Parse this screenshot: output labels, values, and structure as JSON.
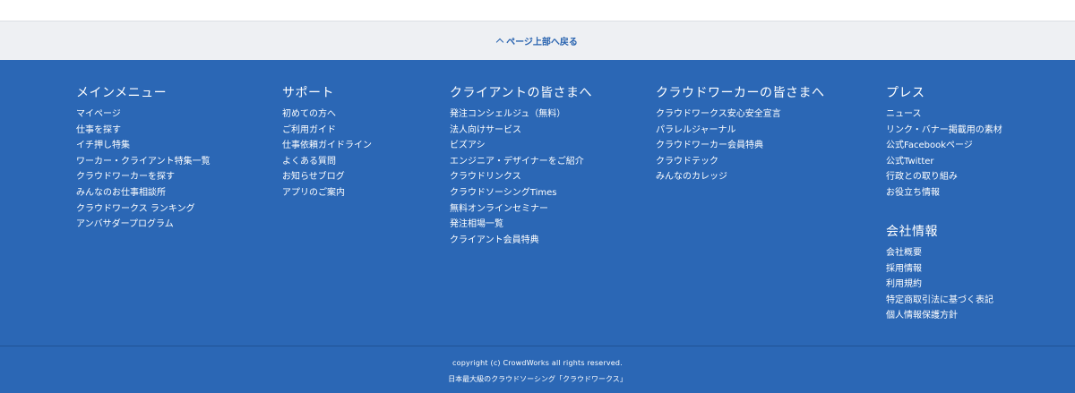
{
  "back_to_top": {
    "label": "ページ上部へ戻る"
  },
  "columns": [
    {
      "heading": "メインメニュー",
      "links": [
        "マイページ",
        "仕事を探す",
        "イチ押し特集",
        "ワーカー・クライアント特集一覧",
        "クラウドワーカーを探す",
        "みんなのお仕事相談所",
        "クラウドワークス ランキング",
        "アンバサダープログラム"
      ]
    },
    {
      "heading": "サポート",
      "links": [
        "初めての方へ",
        "ご利用ガイド",
        "仕事依頼ガイドライン",
        "よくある質問",
        "お知らせブログ",
        "アプリのご案内"
      ]
    },
    {
      "heading": "クライアントの皆さまへ",
      "links": [
        "発注コンシェルジュ（無料）",
        "法人向けサービス",
        "ビズアシ",
        "エンジニア・デザイナーをご紹介",
        "クラウドリンクス",
        "クラウドソーシングTimes",
        "無料オンラインセミナー",
        "発注相場一覧",
        "クライアント会員特典"
      ]
    },
    {
      "heading": "クラウドワーカーの皆さまへ",
      "links": [
        "クラウドワークス安心安全宣言",
        "パラレルジャーナル",
        "クラウドワーカー会員特典",
        "クラウドテック",
        "みんなのカレッジ"
      ]
    },
    {
      "heading": "プレス",
      "links": [
        "ニュース",
        "リンク・バナー掲載用の素材",
        "公式Facebookページ",
        "公式Twitter",
        "行政との取り組み",
        "お役立ち情報"
      ]
    },
    {
      "heading": "会社情報",
      "links": [
        "会社概要",
        "採用情報",
        "利用規約",
        "特定商取引法に基づく表記",
        "個人情報保護方針"
      ]
    }
  ],
  "footer": {
    "copyright": "copyright (c) CrowdWorks all rights reserved.",
    "tagline": "日本最大級のクラウドソーシング「クラウドワークス」"
  },
  "colors": {
    "footer_bg": "#2b67b5",
    "back_to_top_bg": "#eef0f3",
    "link_accent": "#2a64b0"
  }
}
